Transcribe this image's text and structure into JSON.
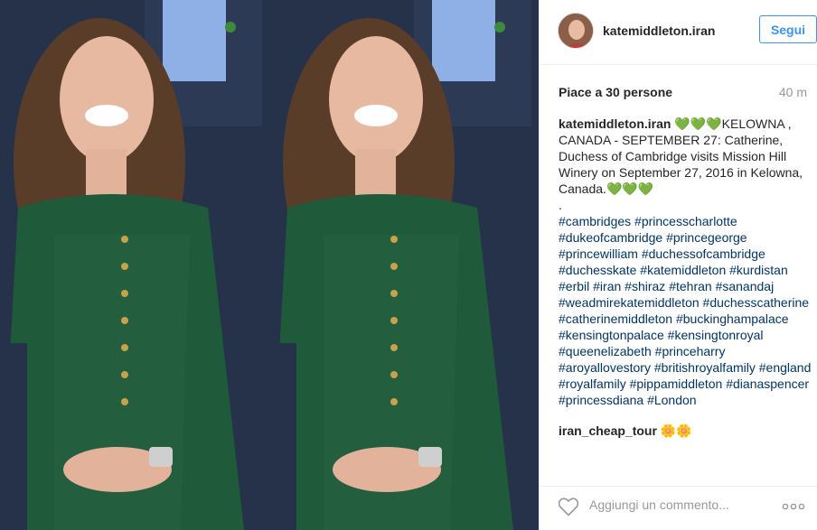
{
  "post": {
    "username": "katemiddleton.iran",
    "follow_label": "Segui",
    "likes_text": "Piace a 30 persone",
    "time_ago": "40 m",
    "caption": {
      "username": "katemiddleton.iran",
      "lead_emoji": "💚💚💚",
      "text": "KELOWNA , CANADA - SEPTEMBER 27: Catherine, Duchess of Cambridge visits Mission Hill Winery on September 27, 2016 in Kelowna, Canada.",
      "trail_emoji": "💚💚💚",
      "dot": ".",
      "hashtags": [
        "#cambridges",
        "#princesscharlotte",
        "#dukeofcambridge",
        "#princegeorge",
        "#princewilliam",
        "#duchessofcambridge",
        "#duchesskate",
        "#katemiddleton",
        "#kurdistan",
        "#erbil",
        "#iran",
        "#shiraz",
        "#tehran",
        "#sanandaj",
        "#weadmirekatemiddleton",
        "#duchesscatherine",
        "#catherinemiddleton",
        "#buckinghampalace",
        "#kensingtonpalace",
        "#kensingtonroyal",
        "#queenelizabeth",
        "#princeharry",
        "#aroyallovestory",
        "#britishroyalfamily",
        "#england",
        "#royalfamily",
        "#pippamiddleton",
        "#dianaspencer",
        "#princessdiana",
        "#London"
      ]
    },
    "comments": [
      {
        "username": "iran_cheap_tour",
        "text": "🌼🌼"
      }
    ],
    "add_comment_placeholder": "Aggiungi un commento...",
    "icons": {
      "like": "heart-outline-icon",
      "more": "more-options-icon"
    },
    "colors": {
      "link_blue": "#3897f0",
      "hashtag": "#003569",
      "muted": "#999999"
    }
  }
}
